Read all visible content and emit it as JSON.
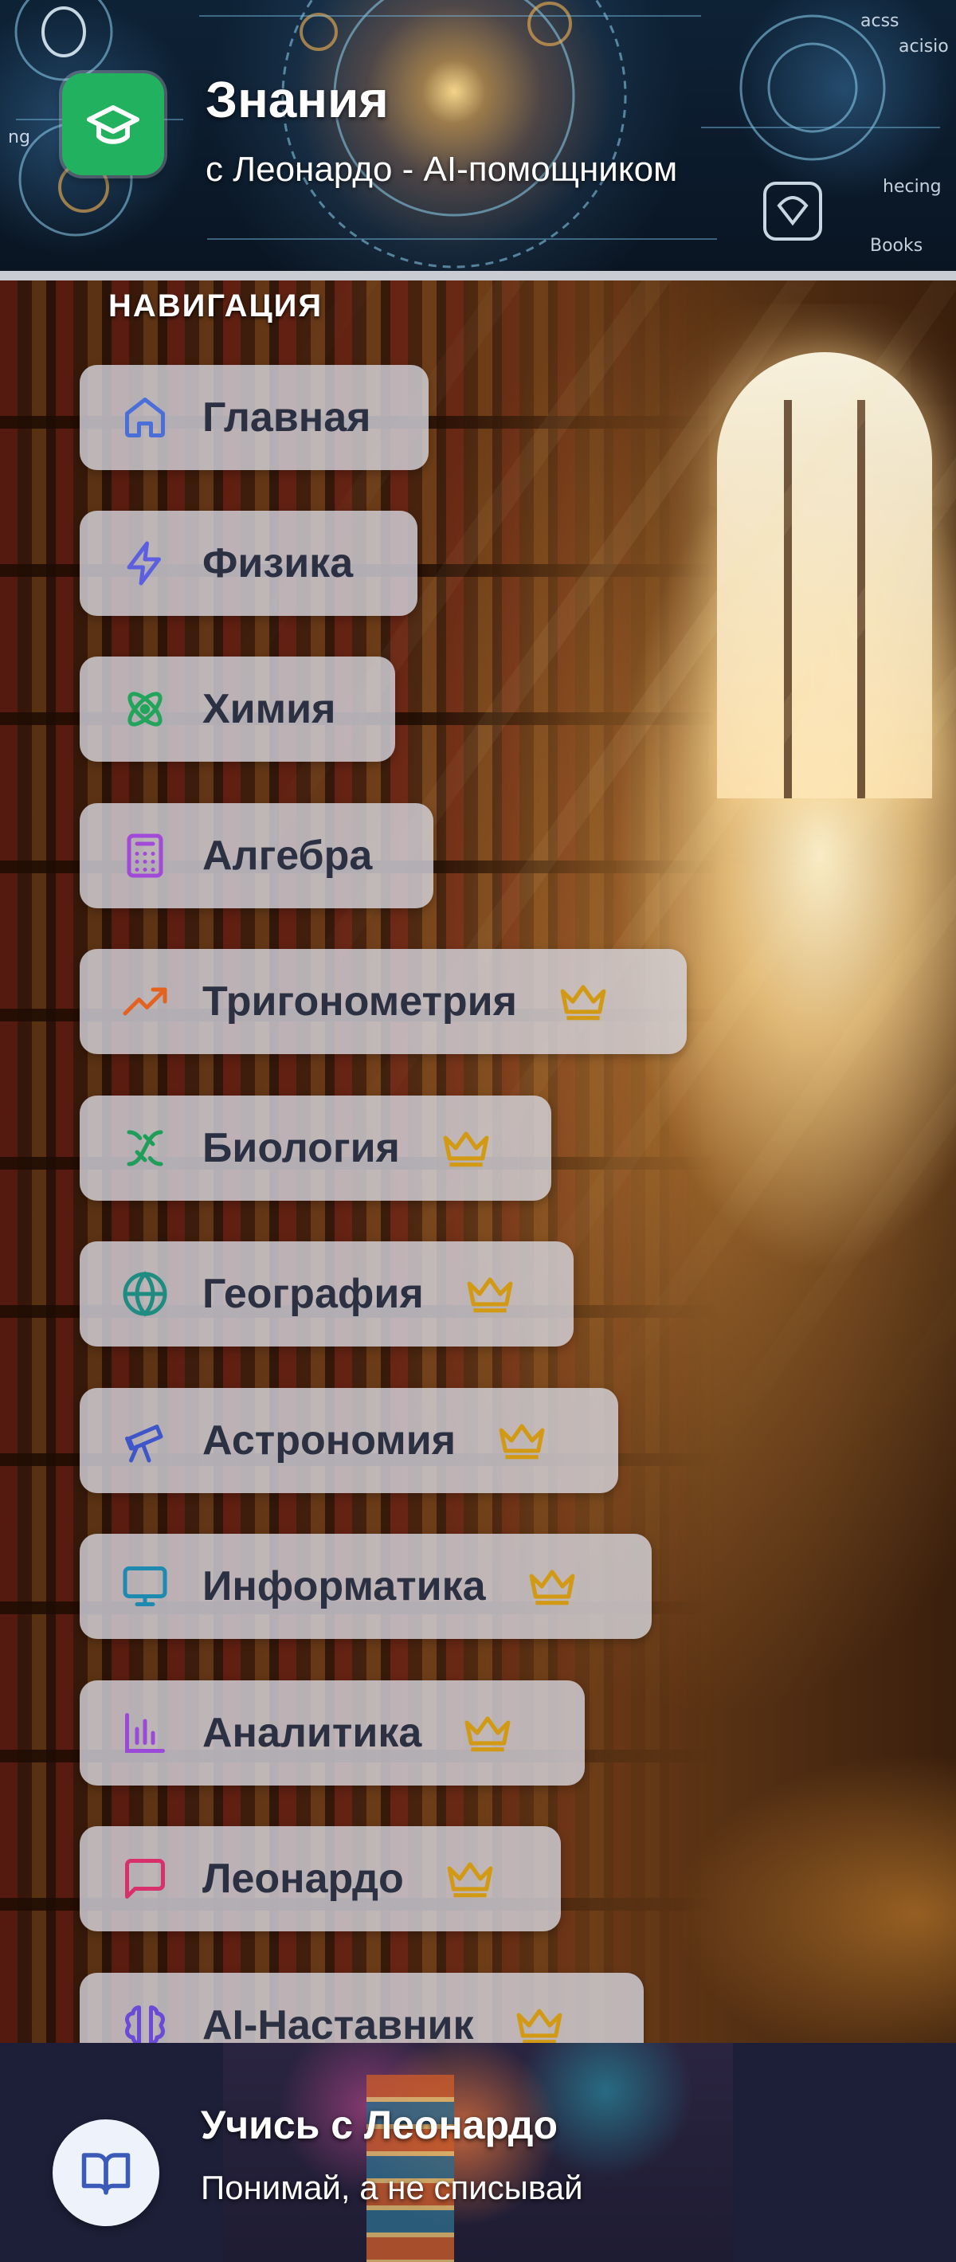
{
  "header": {
    "title": "Знания",
    "subtitle": "с Леонардо - AI-помощником",
    "decor_words": [
      "acss",
      "acisio",
      "ng",
      "hecing",
      "Books"
    ]
  },
  "nav": {
    "heading": "НАВИГАЦИЯ",
    "items": [
      {
        "label": "Главная",
        "icon": "home-icon",
        "color": "#4a6fd8",
        "premium": false
      },
      {
        "label": "Физика",
        "icon": "lightning-icon",
        "color": "#5b5fe0",
        "premium": false
      },
      {
        "label": "Химия",
        "icon": "atom-icon",
        "color": "#22a55a",
        "premium": false
      },
      {
        "label": "Алгебра",
        "icon": "calculator-icon",
        "color": "#a24ad8",
        "premium": false
      },
      {
        "label": "Тригонометрия",
        "icon": "trending-up-icon",
        "color": "#e3621f",
        "premium": true
      },
      {
        "label": "Биология",
        "icon": "dna-icon",
        "color": "#1f9e5a",
        "premium": true
      },
      {
        "label": "География",
        "icon": "globe-icon",
        "color": "#1f8c82",
        "premium": true
      },
      {
        "label": "Астрономия",
        "icon": "telescope-icon",
        "color": "#3f56c8",
        "premium": true
      },
      {
        "label": "Информатика",
        "icon": "monitor-icon",
        "color": "#1e8ab0",
        "premium": true
      },
      {
        "label": "Аналитика",
        "icon": "bar-chart-icon",
        "color": "#9b4ad8",
        "premium": true
      },
      {
        "label": "Леонардо",
        "icon": "message-icon",
        "color": "#d8306a",
        "premium": true
      },
      {
        "label": "AI-Наставник",
        "icon": "brain-icon",
        "color": "#6b4ad8",
        "premium": true
      }
    ],
    "crown_color": "#d29a14"
  },
  "footer": {
    "title": "Учись с Леонардо",
    "subtitle": "Понимай, а не списывай",
    "icon": "book-open-icon"
  }
}
